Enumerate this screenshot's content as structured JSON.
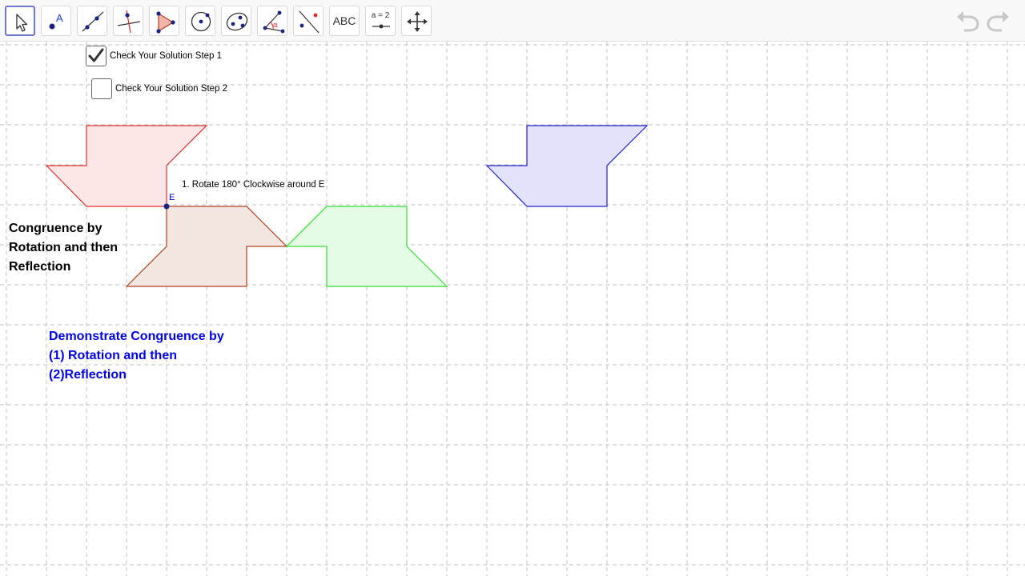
{
  "toolbar": {
    "tools": [
      {
        "name": "move-tool",
        "icon": "arrow-cursor-icon",
        "selected": true
      },
      {
        "name": "point-tool",
        "icon": "point-icon",
        "label": "A"
      },
      {
        "name": "line-tool",
        "icon": "line-icon"
      },
      {
        "name": "perpendicular-line-tool",
        "icon": "perpendicular-line-icon"
      },
      {
        "name": "polygon-tool",
        "icon": "polygon-icon"
      },
      {
        "name": "circle-tool",
        "icon": "circle-with-center-icon"
      },
      {
        "name": "conic-tool",
        "icon": "ellipse-icon"
      },
      {
        "name": "angle-tool",
        "icon": "angle-icon",
        "label": "α"
      },
      {
        "name": "reflect-tool",
        "icon": "reflect-about-line-icon"
      },
      {
        "name": "text-tool",
        "icon": "text-icon",
        "label": "ABC"
      },
      {
        "name": "slider-tool",
        "icon": "slider-icon",
        "label": "a = 2"
      },
      {
        "name": "move-graphics-view-tool",
        "icon": "move-view-icon"
      }
    ],
    "undo_icon": "undo-icon",
    "redo_icon": "redo-icon"
  },
  "checkboxes": [
    {
      "label": "Check Your Solution Step 1",
      "checked": true
    },
    {
      "label": "Check Your Solution Step 2",
      "checked": false
    }
  ],
  "canvas": {
    "rotation_instruction": "1. Rotate 180° Clockwise around E",
    "point_label": "E",
    "title_text": "Congruence by\nRotation and then\nReflection",
    "blue_text": "Demonstrate Congruence by\n(1) Rotation and then\n(2)Reflection"
  },
  "colors": {
    "toolbar_bg": "#f8f8f8",
    "grid_line": "#c0c0c0",
    "red_shape_stroke": "#e03030",
    "red_shape_fill": "#fde6e6",
    "brown_shape_stroke": "#b04020",
    "brown_shape_fill": "#f3e6e0",
    "green_shape_stroke": "#33dd33",
    "green_shape_fill": "#e5fbe5",
    "blue_shape_stroke": "#2222cc",
    "blue_shape_fill": "#e2e2fb",
    "point_color": "#1a237e",
    "selected_tool_border": "#6f76c9",
    "blue_text": "#0000e6"
  }
}
